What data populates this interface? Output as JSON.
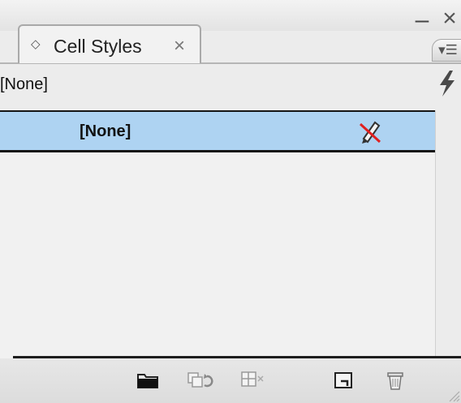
{
  "panel": {
    "tab_label": "Cell Styles",
    "tab_close": "×",
    "tab_toggle": "◇",
    "window_minimize": "–",
    "window_close": "×",
    "menu_icon": "▾☰"
  },
  "current_style": {
    "label": "[None]",
    "quick_apply_icon": "lightning-icon"
  },
  "styles_list": {
    "items": [
      {
        "name": "[None]",
        "selected": true,
        "status_icon": "no-edit-pencil-icon"
      }
    ]
  },
  "toolbar": {
    "icons": [
      "new-style-group-icon",
      "clear-overrides-icon",
      "unlink-style-icon",
      "new-style-icon",
      "delete-style-icon"
    ]
  },
  "colors": {
    "selection": "#aed3f2",
    "panel_bg": "#ececec",
    "no_edit_slash": "#e02020"
  }
}
